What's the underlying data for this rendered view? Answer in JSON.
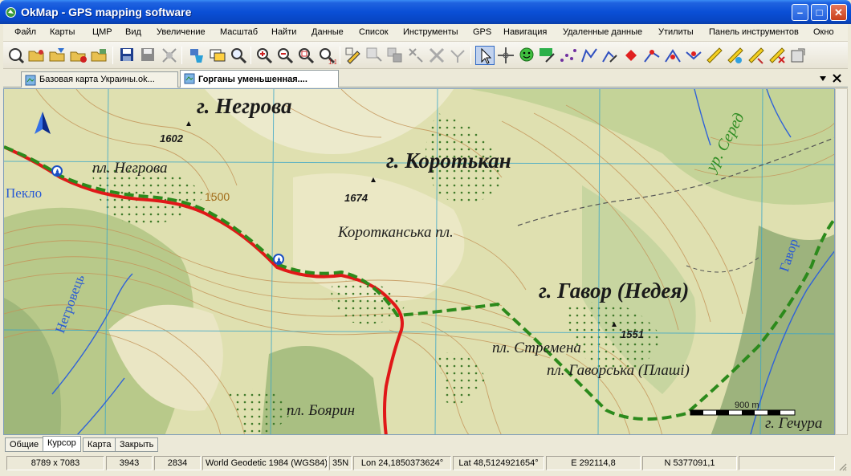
{
  "window": {
    "title": "OkMap - GPS mapping software"
  },
  "menu": [
    "Файл",
    "Карты",
    "ЦМР",
    "Вид",
    "Увеличение",
    "Масштаб",
    "Найти",
    "Данные",
    "Список",
    "Инструменты",
    "GPS",
    "Навигация",
    "Удаленные данные",
    "Утилиты",
    "Панель инструментов",
    "Окно"
  ],
  "toolbar": {
    "icons": [
      "open-map-icon",
      "open-folder-icon",
      "open-calibrated-icon",
      "open-multi-icon",
      "open-image-icon",
      "save-icon",
      "save-as-icon",
      "save-all-icon",
      "paint-bucket-icon",
      "layers-icon",
      "search-icon",
      "zoom-in-icon",
      "zoom-out-icon",
      "zoom-fit-icon",
      "zoom-1-1-icon",
      "edit-pencil-icon",
      "waypoint-tool-icon",
      "layer-tool-icon",
      "select-waypoint-icon",
      "delete-waypoints-icon",
      "merge-icon",
      "pointer-icon",
      "crosshair-icon",
      "smiley-waypoint-icon",
      "add-waypoint-icon",
      "route-tool-icon",
      "track-tool-icon",
      "edit-track-icon",
      "red-diamond-icon",
      "vertex-icon",
      "split-icon",
      "join-icon",
      "ruler-icon",
      "measure-area-icon",
      "ruler-2-icon",
      "eraser-icon",
      "properties-icon"
    ]
  },
  "tabs": [
    {
      "label": "Базовая карта Украины.ok...",
      "active": false
    },
    {
      "label": "Горганы уменьшенная....",
      "active": true
    }
  ],
  "map": {
    "peaks": [
      "г. Негрова",
      "г. Коротькан",
      "г. Гавор (Недея)",
      "г. Гечура"
    ],
    "meadows": [
      "пл. Негрова",
      "Коротканська пл.",
      "пл. Стремена",
      "пл. Гаворська (Плаші)",
      "пл. Боярин"
    ],
    "elevations": [
      "1602",
      "1674",
      "1551"
    ],
    "contour_label": "1500",
    "rivers": [
      "Негровець",
      "Гавор",
      "Пекло"
    ],
    "area_label": "ур. Серед",
    "scale_label": "900 m"
  },
  "bottom_tabs": [
    {
      "label": "Общие",
      "active": false
    },
    {
      "label": "Курсор",
      "active": true
    },
    {
      "label": "Карта",
      "active": false
    },
    {
      "label": "Закрыть",
      "active": false
    }
  ],
  "status": {
    "size": "8789 x 7083",
    "x": "3943",
    "y": "2834",
    "datum": "World Geodetic 1984 (WGS84)",
    "zone": "35N",
    "lon": "Lon 24,1850373624°",
    "lat": "Lat 48,5124921654°",
    "easting": "E 292114,8",
    "northing": "N 5377091,1"
  }
}
